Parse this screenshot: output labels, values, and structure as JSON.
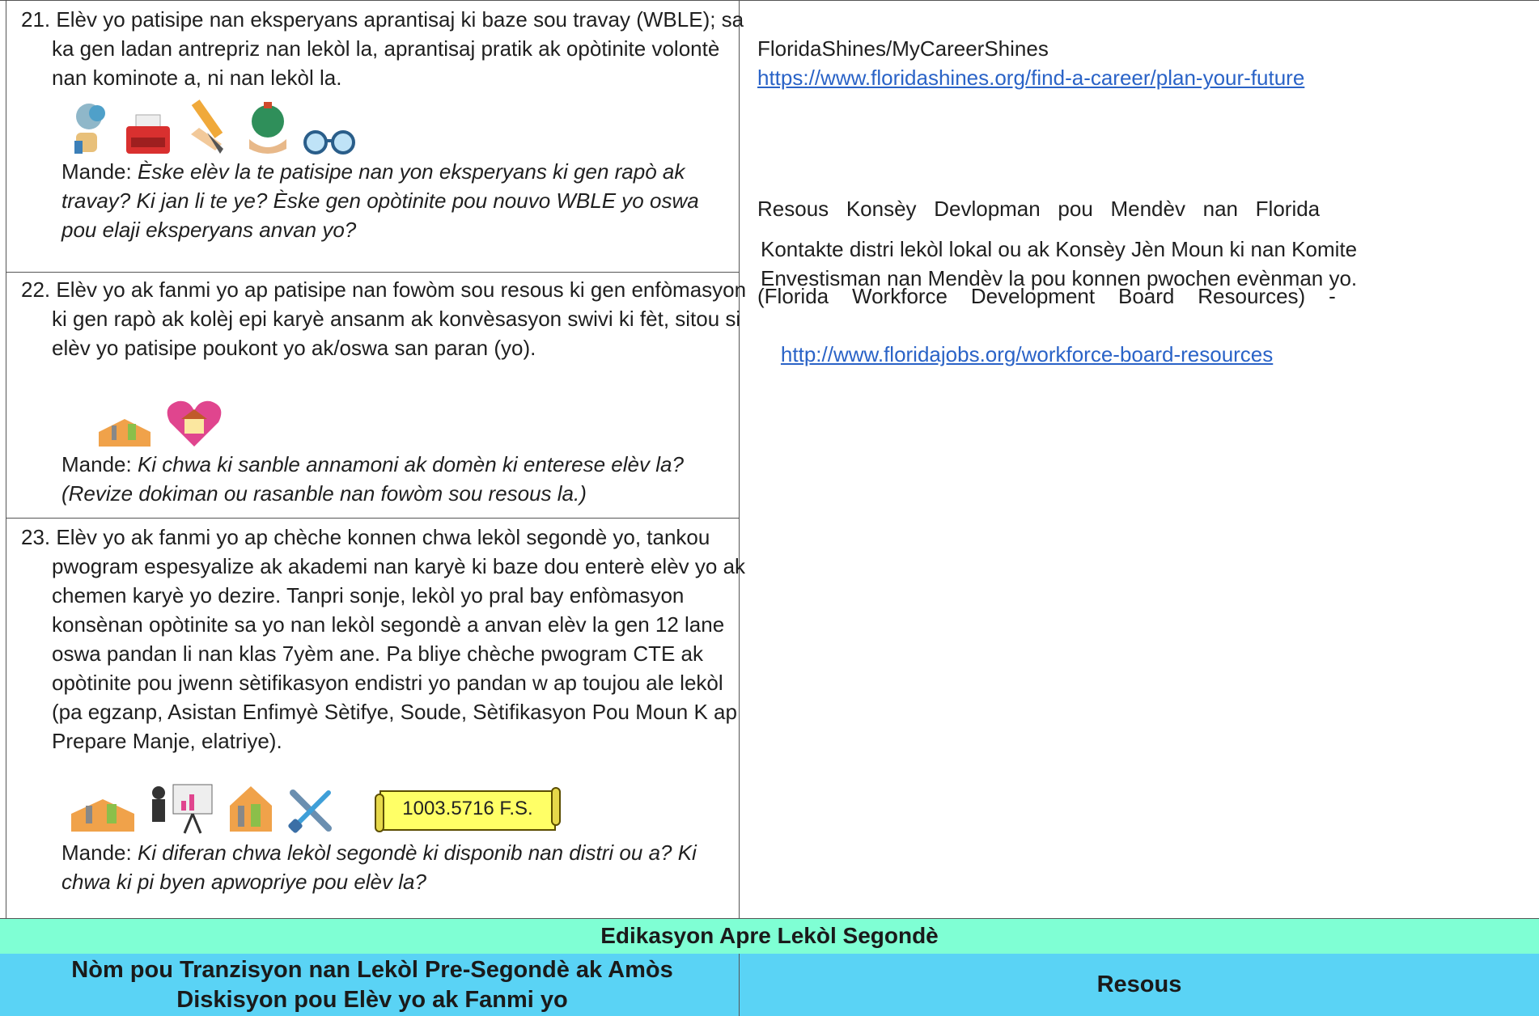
{
  "items": [
    {
      "num": "21.",
      "text": "Elèv yo patisipe nan eksperyans aprantisaj ki baze sou travay (WBLE); sa ka gen ladan antrepriz nan lekòl la, aprantisaj pratik ak opòtinite volontè nan kominote a, ni nan lekòl la.",
      "ask_label": "Mande:",
      "ask_text": "Èske elèv la te patisipe nan yon eksperyans ki gen rapò ak travay? Ki jan li te ye? Èske gen opòtinite pou nouvo WBLE yo oswa pou elaji eksperyans anvan yo?",
      "icons": [
        "speech-hand-icon",
        "typewriter-icon",
        "ruler-pen-icon",
        "globe-hands-icon",
        "glasses-icon"
      ]
    },
    {
      "num": "22.",
      "text": "Elèv yo ak fanmi yo ap patisipe nan fowòm sou resous ki gen enfòmasyon ki gen rapò ak kolèj epi karyè ansanm ak konvèsasyon swivi ki fèt, sitou si elèv yo patisipe poukont yo ak/oswa san paran (yo).",
      "ask_label": "Mande:",
      "ask_text": "Ki chwa ki sanble annamoni ak domèn ki enterese elèv la? (Revize dokiman ou rasanble nan fowòm sou resous la.)",
      "icons": [
        "toolbox-icon",
        "heart-home-icon"
      ]
    },
    {
      "num": "23.",
      "text": "Elèv yo ak fanmi yo ap chèche konnen chwa lekòl segondè yo, tankou pwogram espesyalize ak akademi nan karyè ki baze dou enterè elèv yo ak chemen karyè yo dezire. Tanpri sonje, lekòl yo pral bay enfòmasyon konsènan opòtinite sa yo nan lekòl segondè a anvan elèv la gen 12 lane oswa pandan li nan klas 7yèm ane. Pa bliye chèche pwogram CTE ak opòtinite pou jwenn sètifikasyon endistri yo pandan w ap toujou ale lekòl (pa egzanp, Asistan Enfimyè Sètifye, Soude, Sètifikasyon Pou Moun K ap Prepare Manje, elatriye).",
      "ask_label": "Mande:",
      "ask_text": "Ki diferan chwa lekòl segondè ki disponib nan distri ou a? Ki chwa ki pi byen apwopriye pou elèv la?",
      "icons": [
        "toolbox-icon",
        "presenter-chart-icon",
        "house-tools-icon",
        "wrench-screwdriver-icon"
      ],
      "statute": "1003.5716 F.S."
    }
  ],
  "resources": {
    "r1_name": "FloridaShines/MyCareerShines",
    "r1_link": "https://www.floridashines.org/find-a-career/plan-your-future",
    "r2_line1": "Resous   Konsèy   Devlopman   pou   Mendèv   nan   Florida",
    "r2_line2": "(Florida    Workforce    Development    Board    Resources)    -",
    "r2_link": "http://www.floridajobs.org/workforce-board-resources",
    "r3_text": "Kontakte distri lekòl lokal ou ak Konsèy Jèn Moun ki nan Komite Envestisman nan Mendèv la pou konnen pwochen evènman yo."
  },
  "section_title": "Edikasyon Apre Lekòl Segondè",
  "col_left_header": "Nòm pou Tranzisyon nan Lekòl Pre-Segondè ak Amòs Diskisyon pou Elèv yo ak Fanmi yo",
  "col_right_header": "Resous",
  "colors": {
    "band_green": "#7fffd4",
    "band_blue": "#5ad3f5",
    "link": "#2a63c7"
  }
}
